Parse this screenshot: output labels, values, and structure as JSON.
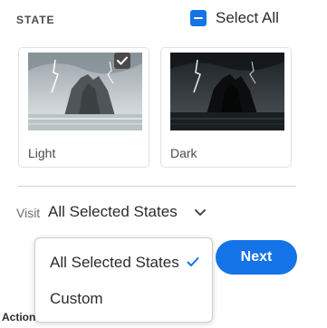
{
  "state_section": {
    "title": "STATE",
    "select_all_label": "Select All",
    "cards": [
      {
        "label": "Light",
        "checked": true
      },
      {
        "label": "Dark",
        "checked": false
      }
    ]
  },
  "visit": {
    "label": "Visit",
    "selected": "All Selected States",
    "options": [
      "All Selected States",
      "Custom"
    ]
  },
  "next_button": {
    "label": "Next"
  },
  "footer": {
    "partial_label": "Action"
  },
  "colors": {
    "accent": "#1473e6",
    "checkbox_dark": "#4a4a4a"
  }
}
